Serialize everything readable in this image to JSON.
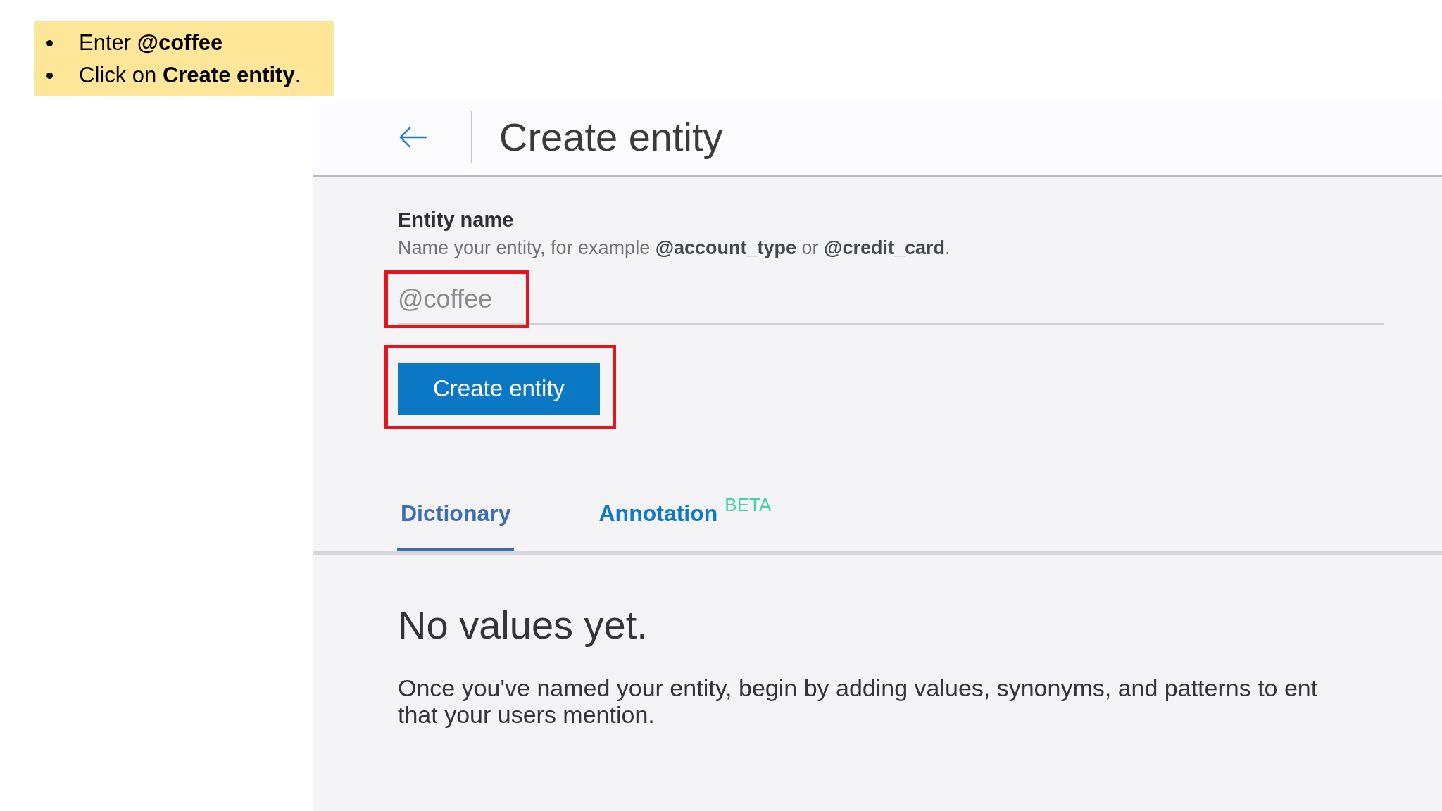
{
  "callout": [
    "Enter **@coffee**",
    "Click on **Create entity**."
  ],
  "header": {
    "title": "Create entity"
  },
  "entity_name": {
    "label": "Entity name",
    "help": "Name your entity, for example **@account_type** or **@credit_card**.",
    "value": "@coffee",
    "highlighted": true
  },
  "create_button": {
    "label": "Create entity",
    "highlighted": true
  },
  "tabs": [
    {
      "label": "Dictionary",
      "selected": true
    },
    {
      "label": "Annotation",
      "selected": false,
      "badge": "BETA"
    }
  ],
  "empty_state": {
    "title": "No values yet.",
    "lines": [
      "Once you've named your entity, begin by adding values, synonyms, and patterns to ent",
      "that your users mention."
    ]
  }
}
